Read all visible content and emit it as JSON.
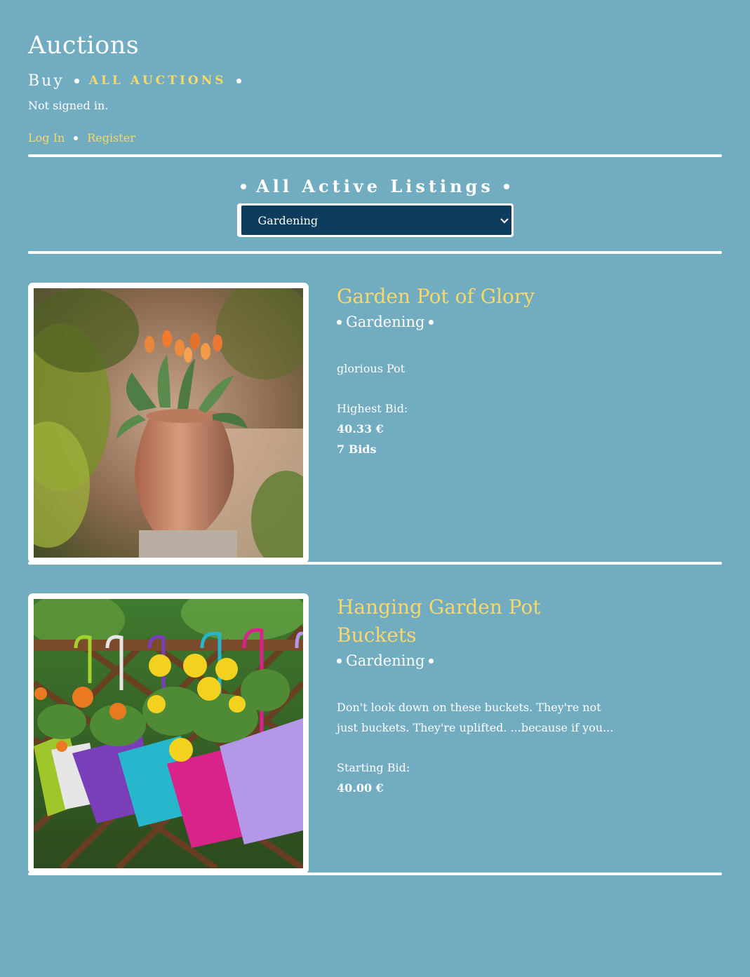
{
  "header": {
    "title": "Auctions",
    "nav_buy": "Buy",
    "nav_all": "ALL AUCTIONS"
  },
  "auth": {
    "status": "Not signed in.",
    "login": "Log In",
    "register": "Register"
  },
  "filter": {
    "heading": "All Active Listings",
    "selected": "Gardening"
  },
  "listings": [
    {
      "title": "Garden Pot of Glory",
      "category": "Gardening",
      "description": "glorious Pot",
      "bid_label": "Highest Bid:",
      "bid_value": "40.33 €",
      "bid_count": "7 Bids"
    },
    {
      "title": "Hanging Garden Pot Buckets",
      "category": "Gardening",
      "description": "Don't look down on these buckets. They're not just buckets. They're uplifted. ...because if you...",
      "bid_label": "Starting Bid:",
      "bid_value": "40.00 €"
    }
  ],
  "colors": {
    "background": "#72acc1",
    "accent": "#f9d86a",
    "select_bg": "#0e3c5c"
  }
}
